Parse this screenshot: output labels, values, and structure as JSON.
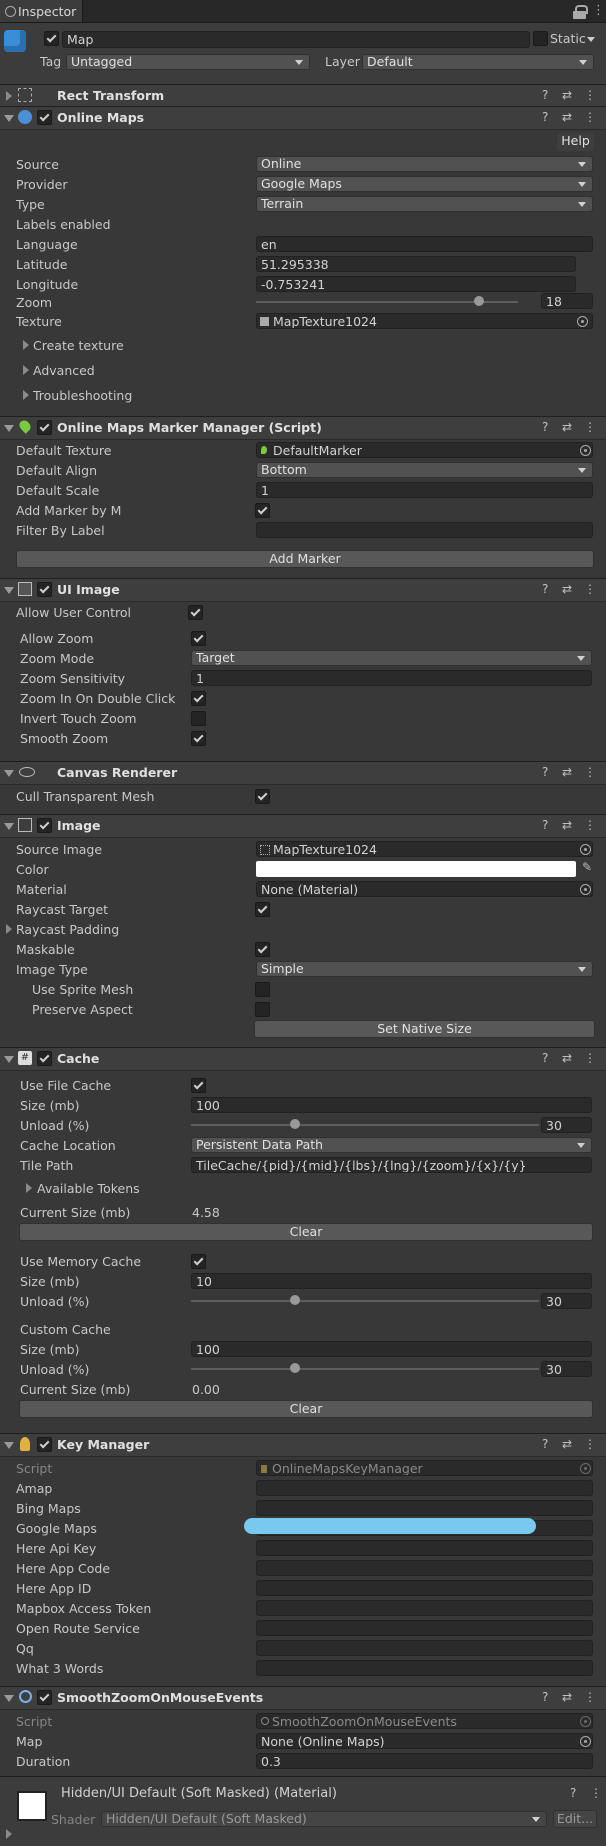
{
  "tab": {
    "title": "Inspector"
  },
  "object": {
    "name": "Map",
    "static_label": "Static",
    "tag_label": "Tag",
    "tag_value": "Untagged",
    "layer_label": "Layer",
    "layer_value": "Default"
  },
  "components": {
    "rect_transform": {
      "title": "Rect Transform"
    },
    "online_maps": {
      "title": "Online Maps",
      "help": "Help",
      "source_label": "Source",
      "source_value": "Online",
      "provider_label": "Provider",
      "provider_value": "Google Maps",
      "type_label": "Type",
      "type_value": "Terrain",
      "labels_enabled": "Labels enabled",
      "language_label": "Language",
      "language_value": "en",
      "latitude_label": "Latitude",
      "latitude_value": "51.295338",
      "longitude_label": "Longitude",
      "longitude_value": "-0.753241",
      "zoom_label": "Zoom",
      "zoom_value": "18",
      "zoom_level": 0.85,
      "texture_label": "Texture",
      "texture_value": "MapTexture1024",
      "create_texture": "Create texture",
      "advanced": "Advanced",
      "troubleshooting": "Troubleshooting"
    },
    "marker_manager": {
      "title": "Online Maps Marker Manager (Script)",
      "default_texture_label": "Default Texture",
      "default_texture_value": "DefaultMarker",
      "default_align_label": "Default Align",
      "default_align_value": "Bottom",
      "default_scale_label": "Default Scale",
      "default_scale_value": "1",
      "add_marker_by_m": "Add Marker by M",
      "filter_by_label": "Filter By Label",
      "add_marker_button": "Add Marker"
    },
    "ui_image": {
      "title": "UI Image",
      "allow_user_control": "Allow User Control",
      "allow_zoom": "Allow Zoom",
      "zoom_mode_label": "Zoom Mode",
      "zoom_mode_value": "Target",
      "zoom_sensitivity_label": "Zoom Sensitivity",
      "zoom_sensitivity_value": "1",
      "zoom_in_double_click": "Zoom In On Double Click",
      "invert_touch_zoom": "Invert Touch Zoom",
      "smooth_zoom": "Smooth Zoom"
    },
    "canvas_renderer": {
      "title": "Canvas Renderer",
      "cull_transparent_mesh": "Cull Transparent Mesh"
    },
    "image": {
      "title": "Image",
      "source_image_label": "Source Image",
      "source_image_value": "MapTexture1024",
      "color_label": "Color",
      "color_value": "#ffffff",
      "material_label": "Material",
      "material_value": "None (Material)",
      "raycast_target": "Raycast Target",
      "raycast_padding": "Raycast Padding",
      "maskable": "Maskable",
      "image_type_label": "Image Type",
      "image_type_value": "Simple",
      "use_sprite_mesh": "Use Sprite Mesh",
      "preserve_aspect": "Preserve Aspect",
      "set_native_size": "Set Native Size"
    },
    "cache": {
      "title": "Cache",
      "use_file_cache": "Use File Cache",
      "size_label": "Size (mb)",
      "file_size_value": "100",
      "unload_label": "Unload (%)",
      "file_unload_value": "30",
      "file_unload_level": 0.3,
      "cache_location_label": "Cache Location",
      "cache_location_value": "Persistent Data Path",
      "tile_path_label": "Tile Path",
      "tile_path_value": "TileCache/{pid}/{mid}/{lbs}/{lng}/{zoom}/{x}/{y}",
      "available_tokens": "Available Tokens",
      "current_size_label": "Current Size (mb)",
      "current_size_value": "4.58",
      "clear": "Clear",
      "use_memory_cache": "Use Memory Cache",
      "memory_size_value": "10",
      "memory_unload_value": "30",
      "memory_unload_level": 0.3,
      "custom_cache": "Custom Cache",
      "custom_size_value": "100",
      "custom_unload_value": "30",
      "custom_unload_level": 0.3,
      "custom_current_size_value": "0.00"
    },
    "key_manager": {
      "title": "Key Manager",
      "script_label": "Script",
      "script_value": "OnlineMapsKeyManager",
      "keys": [
        "Amap",
        "Bing Maps",
        "Google Maps",
        "Here Api Key",
        "Here App Code",
        "Here App ID",
        "Mapbox Access Token",
        "Open Route Service",
        "Qq",
        "What 3 Words"
      ]
    },
    "smooth_zoom": {
      "title": "SmoothZoomOnMouseEvents",
      "script_label": "Script",
      "script_value": "SmoothZoomOnMouseEvents",
      "map_label": "Map",
      "map_value": "None (Online Maps)",
      "duration_label": "Duration",
      "duration_value": "0.3"
    },
    "material": {
      "title": "Hidden/UI Default (Soft Masked) (Material)",
      "shader_label": "Shader",
      "shader_value": "Hidden/UI Default (Soft Masked)",
      "edit_label": "Edit..."
    }
  },
  "icons": {
    "help": "?",
    "preset": "⇄",
    "menu": "⋮",
    "lock": "lock-icon"
  }
}
